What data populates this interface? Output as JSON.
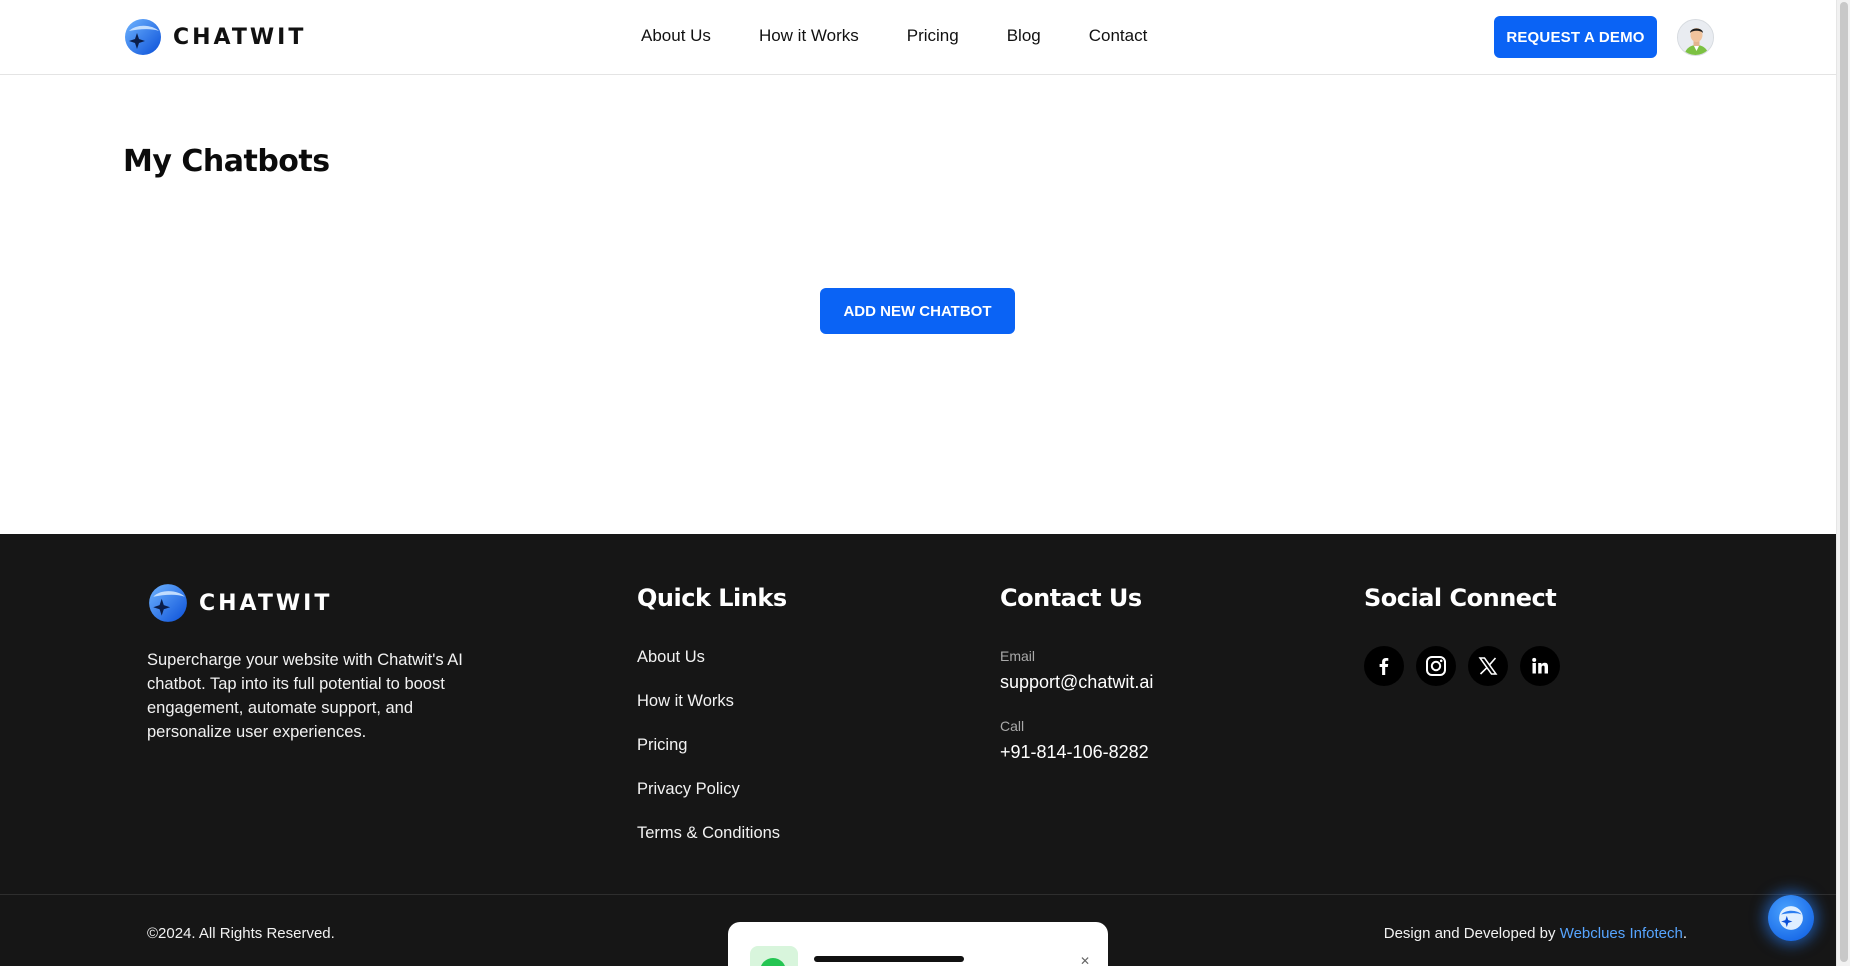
{
  "brand": {
    "name": "CHATWIT"
  },
  "nav": {
    "items": [
      "About Us",
      "How it Works",
      "Pricing",
      "Blog",
      "Contact"
    ],
    "demo_button": "REQUEST A DEMO"
  },
  "main": {
    "title": "My Chatbots",
    "add_button": "ADD NEW CHATBOT"
  },
  "footer": {
    "brand_name": "CHATWIT",
    "description": "Supercharge your website with Chatwit's AI chatbot. Tap into its full potential to boost engagement, automate support, and personalize user experiences.",
    "quick_links": {
      "title": "Quick Links",
      "items": [
        "About Us",
        "How it Works",
        "Pricing",
        "Privacy Policy",
        "Terms & Conditions"
      ]
    },
    "contact": {
      "title": "Contact Us",
      "email_label": "Email",
      "email": "support@chatwit.ai",
      "call_label": "Call",
      "phone": "+91-814-106-8282"
    },
    "social": {
      "title": "Social Connect",
      "icons": [
        "facebook-icon",
        "instagram-icon",
        "x-icon",
        "linkedin-icon"
      ]
    },
    "copyright": "©2024. All Rights Reserved.",
    "credit_prefix": "Design and Developed by ",
    "credit_company": "Webclues Infotech",
    "credit_suffix": "."
  },
  "colors": {
    "accent": "#0a63f5",
    "footer_bg": "#161616",
    "link_blue": "#57a5ff"
  }
}
